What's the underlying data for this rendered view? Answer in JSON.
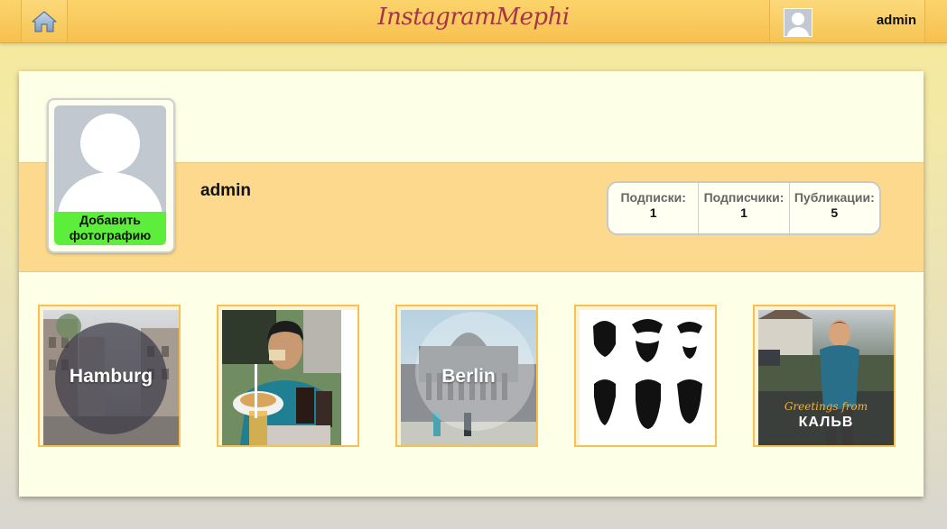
{
  "header": {
    "logo": "InstagramMephi",
    "user_name": "admin"
  },
  "profile": {
    "name": "admin",
    "add_photo_label": "Добавить фотографию",
    "stats": [
      {
        "label": "Подписки:",
        "value": "1"
      },
      {
        "label": "Подписчики:",
        "value": "1"
      },
      {
        "label": "Публикации:",
        "value": "5"
      }
    ]
  },
  "posts": [
    {
      "overlay": "Hamburg"
    },
    {
      "overlay": ""
    },
    {
      "overlay": "Berlin"
    },
    {
      "overlay": ""
    },
    {
      "overlay_script": "Greetings from",
      "overlay_title": "КАЛЬВ"
    }
  ],
  "colors": {
    "header": "#f7c04f",
    "card": "#fdffe6",
    "band": "#fcd98c",
    "add_photo": "#5dee3c",
    "post_border": "#f7c050",
    "logo": "#a8344a"
  },
  "icons": {
    "home": "home-icon",
    "avatar": "user-silhouette-icon"
  }
}
